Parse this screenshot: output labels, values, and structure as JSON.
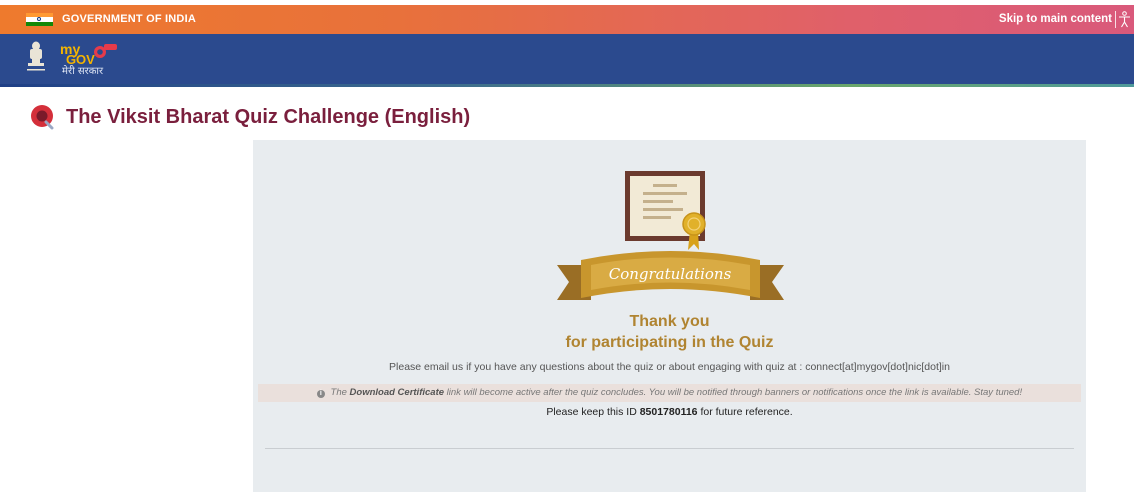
{
  "gov_bar": {
    "label": "GOVERNMENT OF INDIA",
    "skip_link": "Skip to main content"
  },
  "header": {
    "logo_sub": "मेरी सरकार"
  },
  "page": {
    "title": "The Viksit Bharat Quiz Challenge (English)"
  },
  "result": {
    "ribbon_text": "Congratulations",
    "thank_line1": "Thank you",
    "thank_line2": "for participating in the Quiz",
    "email_note": "Please email us if you have any questions about the quiz or about engaging with quiz at : connect[at]mygov[dot]nic[dot]in",
    "info_prefix": "The",
    "info_bold": "Download Certificate",
    "info_suffix": "link will become active after the quiz concludes. You will be notified through banners or notifications once the link is available. Stay tuned!",
    "id_prefix": "Please keep this ID",
    "id_value": "8501780116",
    "id_suffix": "for future reference."
  },
  "colors": {
    "title": "#7a1f3d",
    "header_blue": "#2b4a8e",
    "gold": "#b08431",
    "panel_bg": "#e8ecef"
  }
}
